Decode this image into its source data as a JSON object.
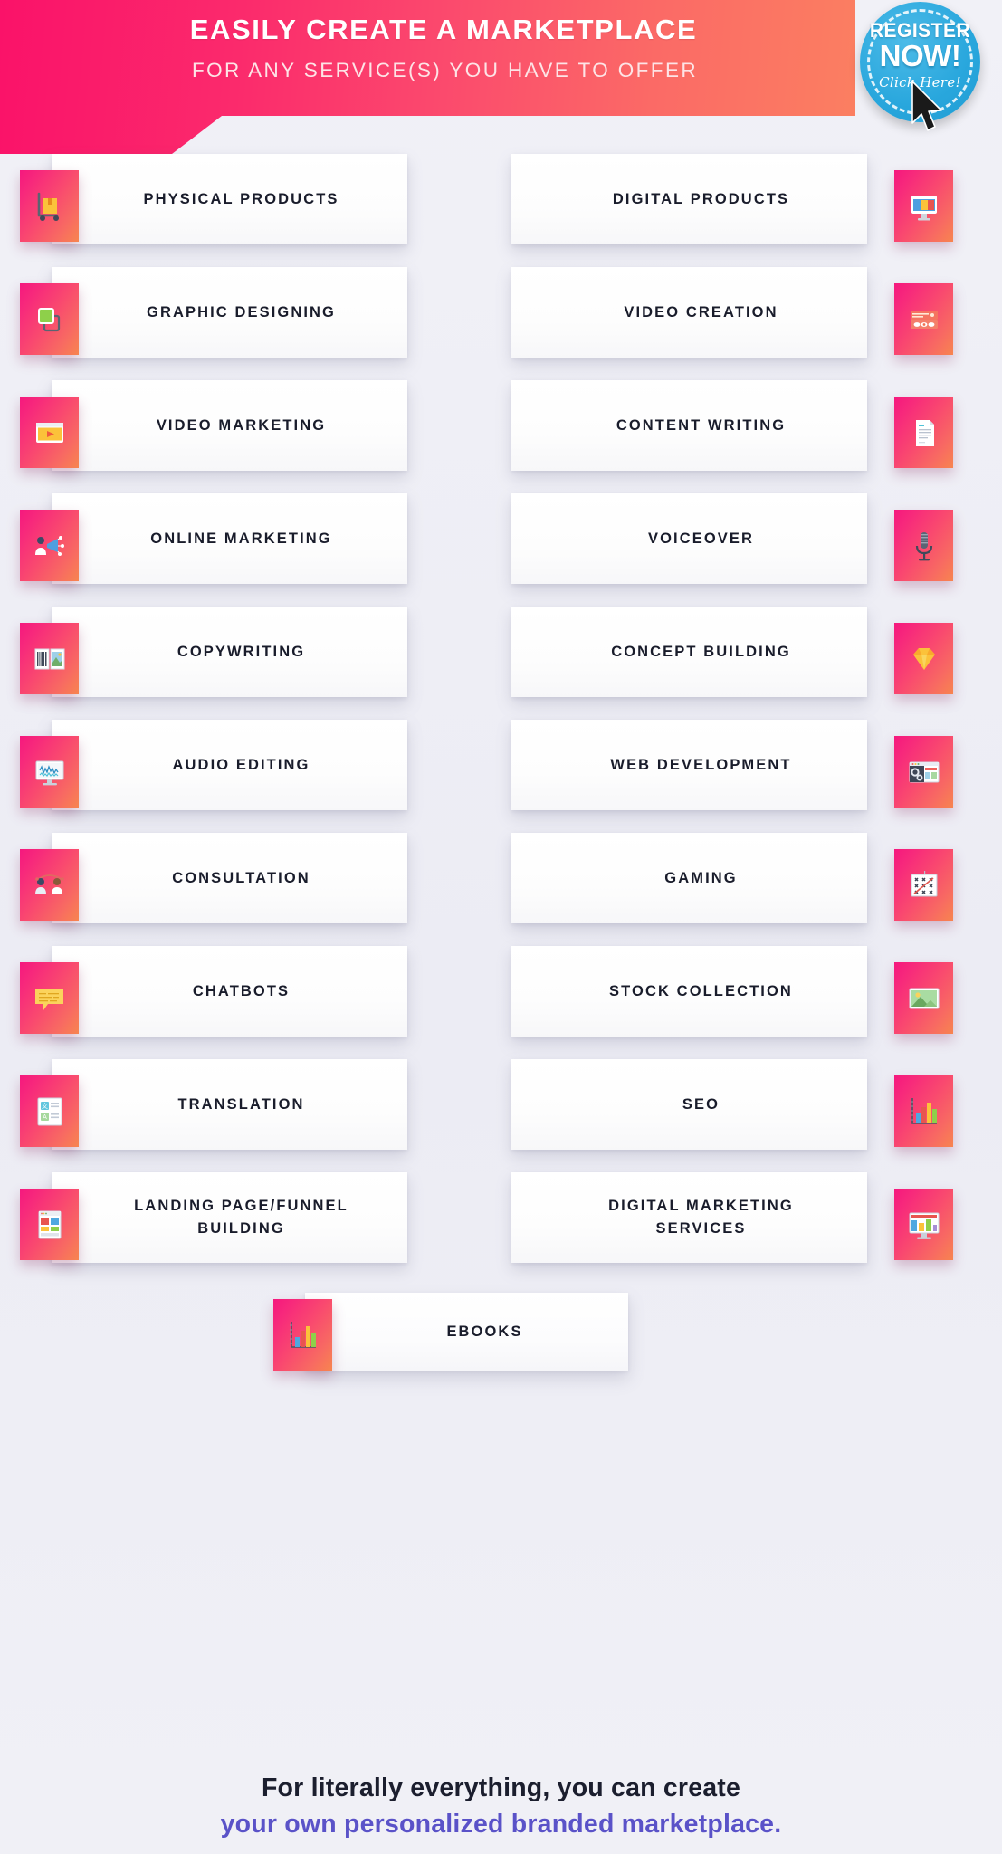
{
  "header": {
    "title": "EASILY CREATE A MARKETPLACE",
    "subtitle": "FOR ANY SERVICE(S) YOU HAVE TO OFFER",
    "banner_color_start": "#fa1269",
    "banner_color_end": "#fb7f61",
    "badge": {
      "line1": "REGISTER",
      "line2": "NOW!",
      "line3": "Click Here!",
      "color": "#29a7dd"
    }
  },
  "services": {
    "tile_gradient_start": "#f5187e",
    "tile_gradient_end": "#f7854f",
    "rows": [
      {
        "left": {
          "label": "PHYSICAL PRODUCTS",
          "icon": "hand-truck-boxes-icon"
        },
        "right": {
          "label": "DIGITAL PRODUCTS",
          "icon": "desktop-monitor-icon"
        }
      },
      {
        "left": {
          "label": "GRAPHIC DESIGNING",
          "icon": "overlapping-squares-icon"
        },
        "right": {
          "label": "VIDEO CREATION",
          "icon": "video-editor-timeline-icon"
        }
      },
      {
        "left": {
          "label": "VIDEO MARKETING",
          "icon": "video-player-window-icon"
        },
        "right": {
          "label": "CONTENT WRITING",
          "icon": "document-page-icon"
        }
      },
      {
        "left": {
          "label": "ONLINE MARKETING",
          "icon": "megaphone-person-icon"
        },
        "right": {
          "label": "VOICEOVER",
          "icon": "microphone-icon"
        }
      },
      {
        "left": {
          "label": "COPYWRITING",
          "icon": "open-book-icon"
        },
        "right": {
          "label": "CONCEPT BUILDING",
          "icon": "diamond-icon"
        }
      },
      {
        "left": {
          "label": "AUDIO EDITING",
          "icon": "audio-waveform-monitor-icon"
        },
        "right": {
          "label": "WEB DEVELOPMENT",
          "icon": "browser-gears-icon"
        }
      },
      {
        "left": {
          "label": "CONSULTATION",
          "icon": "two-people-chat-icon"
        },
        "right": {
          "label": "GAMING",
          "icon": "strategy-board-icon"
        }
      },
      {
        "left": {
          "label": "CHATBOTS",
          "icon": "speech-bubble-icon"
        },
        "right": {
          "label": "STOCK COLLECTION",
          "icon": "photo-image-icon"
        }
      },
      {
        "left": {
          "label": "TRANSLATION",
          "icon": "translate-documents-icon"
        },
        "right": {
          "label": "SEO",
          "icon": "bar-chart-growth-icon"
        }
      },
      {
        "left": {
          "label": "LANDING PAGE/FUNNEL\nBUILDING",
          "icon": "page-layout-icon"
        },
        "right": {
          "label": "DIGITAL MARKETING\nSERVICES",
          "icon": "monitor-dashboard-icon"
        }
      }
    ],
    "final": {
      "label": "EBOOKS",
      "icon": "bar-chart-growth-icon"
    }
  },
  "footer": {
    "line1": "For literally everything, you can create",
    "line2": "your own personalized branded marketplace.",
    "line2_color": "#5a52c8"
  }
}
